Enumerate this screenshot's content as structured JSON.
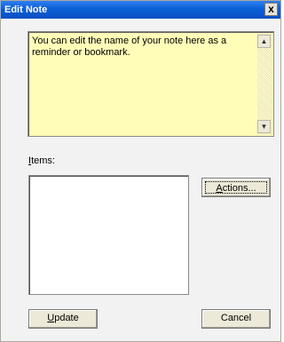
{
  "window": {
    "title": "Edit Note",
    "close_glyph": "x"
  },
  "note": {
    "text": "You can edit the name of your note here as a reminder or bookmark.",
    "background_color": "#fffdb8",
    "scroll_up_icon": "scroll-up-arrow",
    "scroll_down_icon": "scroll-down-arrow",
    "scroll_up_glyph": "▲",
    "scroll_down_glyph": "▼"
  },
  "items": {
    "label_access_key": "I",
    "label_rest": "tems:",
    "values": []
  },
  "buttons": {
    "actions_access_key": "A",
    "actions_rest": "ctions...",
    "update_access_key": "U",
    "update_rest": "pdate",
    "cancel_label": "Cancel"
  },
  "colors": {
    "titlebar": "#0b5fd6",
    "dialog_background": "#f2f2f2"
  }
}
